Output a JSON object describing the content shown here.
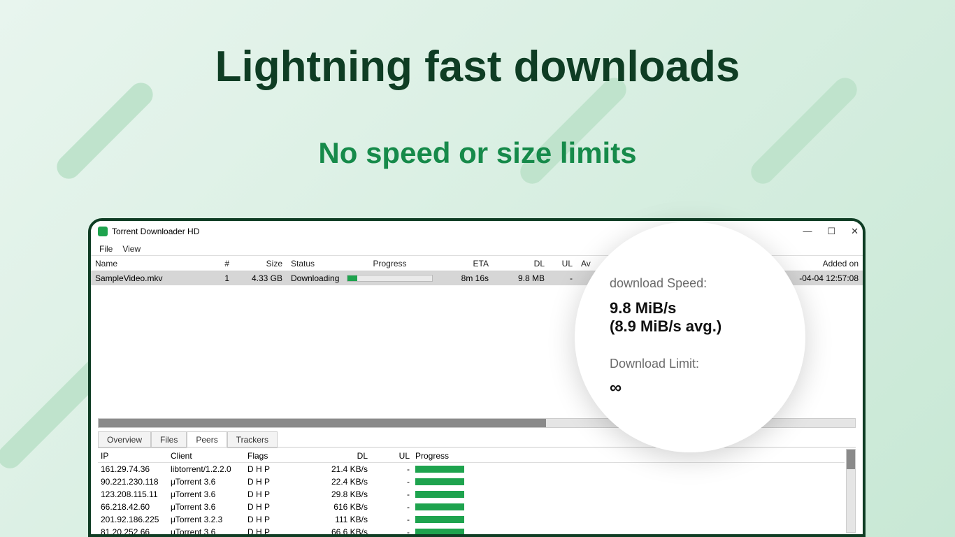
{
  "headline": "Lightning fast downloads",
  "subhead": "No speed or size limits",
  "app": {
    "title": "Torrent Downloader HD",
    "menu": {
      "file": "File",
      "view": "View"
    }
  },
  "columns": {
    "name": "Name",
    "num": "#",
    "size": "Size",
    "status": "Status",
    "progress": "Progress",
    "eta": "ETA",
    "dl": "DL",
    "ul": "UL",
    "av": "Av",
    "added": "Added on"
  },
  "row": {
    "name": "SampleVideo.mkv",
    "num": "1",
    "size": "4.33 GB",
    "status": "Downloading",
    "eta": "8m 16s",
    "dl": "9.8  MB",
    "ul": "-",
    "added": "-04-04 12:57:08"
  },
  "tabs": {
    "overview": "Overview",
    "files": "Files",
    "peers": "Peers",
    "trackers": "Trackers"
  },
  "pcols": {
    "ip": "IP",
    "client": "Client",
    "flags": "Flags",
    "dl": "DL",
    "ul": "UL",
    "progress": "Progress"
  },
  "peers": [
    {
      "ip": "161.29.74.36",
      "client": "libtorrent/1.2.2.0",
      "flags": "D H P",
      "dl": "21.4 KB/s",
      "ul": "-"
    },
    {
      "ip": "90.221.230.118",
      "client": "μTorrent 3.6",
      "flags": "D H P",
      "dl": "22.4 KB/s",
      "ul": "-"
    },
    {
      "ip": "123.208.115.11",
      "client": "μTorrent 3.6",
      "flags": "D H P",
      "dl": "29.8 KB/s",
      "ul": "-"
    },
    {
      "ip": "66.218.42.60",
      "client": "μTorrent 3.6",
      "flags": "D H P",
      "dl": "616 KB/s",
      "ul": "-"
    },
    {
      "ip": "201.92.186.225",
      "client": "μTorrent 3.2.3",
      "flags": "D H P",
      "dl": "111 KB/s",
      "ul": "-"
    },
    {
      "ip": "81.20.252.66",
      "client": "μTorrent 3.6",
      "flags": "D H P",
      "dl": "66.6 KB/s",
      "ul": "-"
    }
  ],
  "bubble": {
    "label": "download Speed:",
    "speed": "9.8 MiB/s",
    "avg": "(8.9 MiB/s avg.)",
    "limit_label": "Download Limit:",
    "infinity": "∞"
  }
}
